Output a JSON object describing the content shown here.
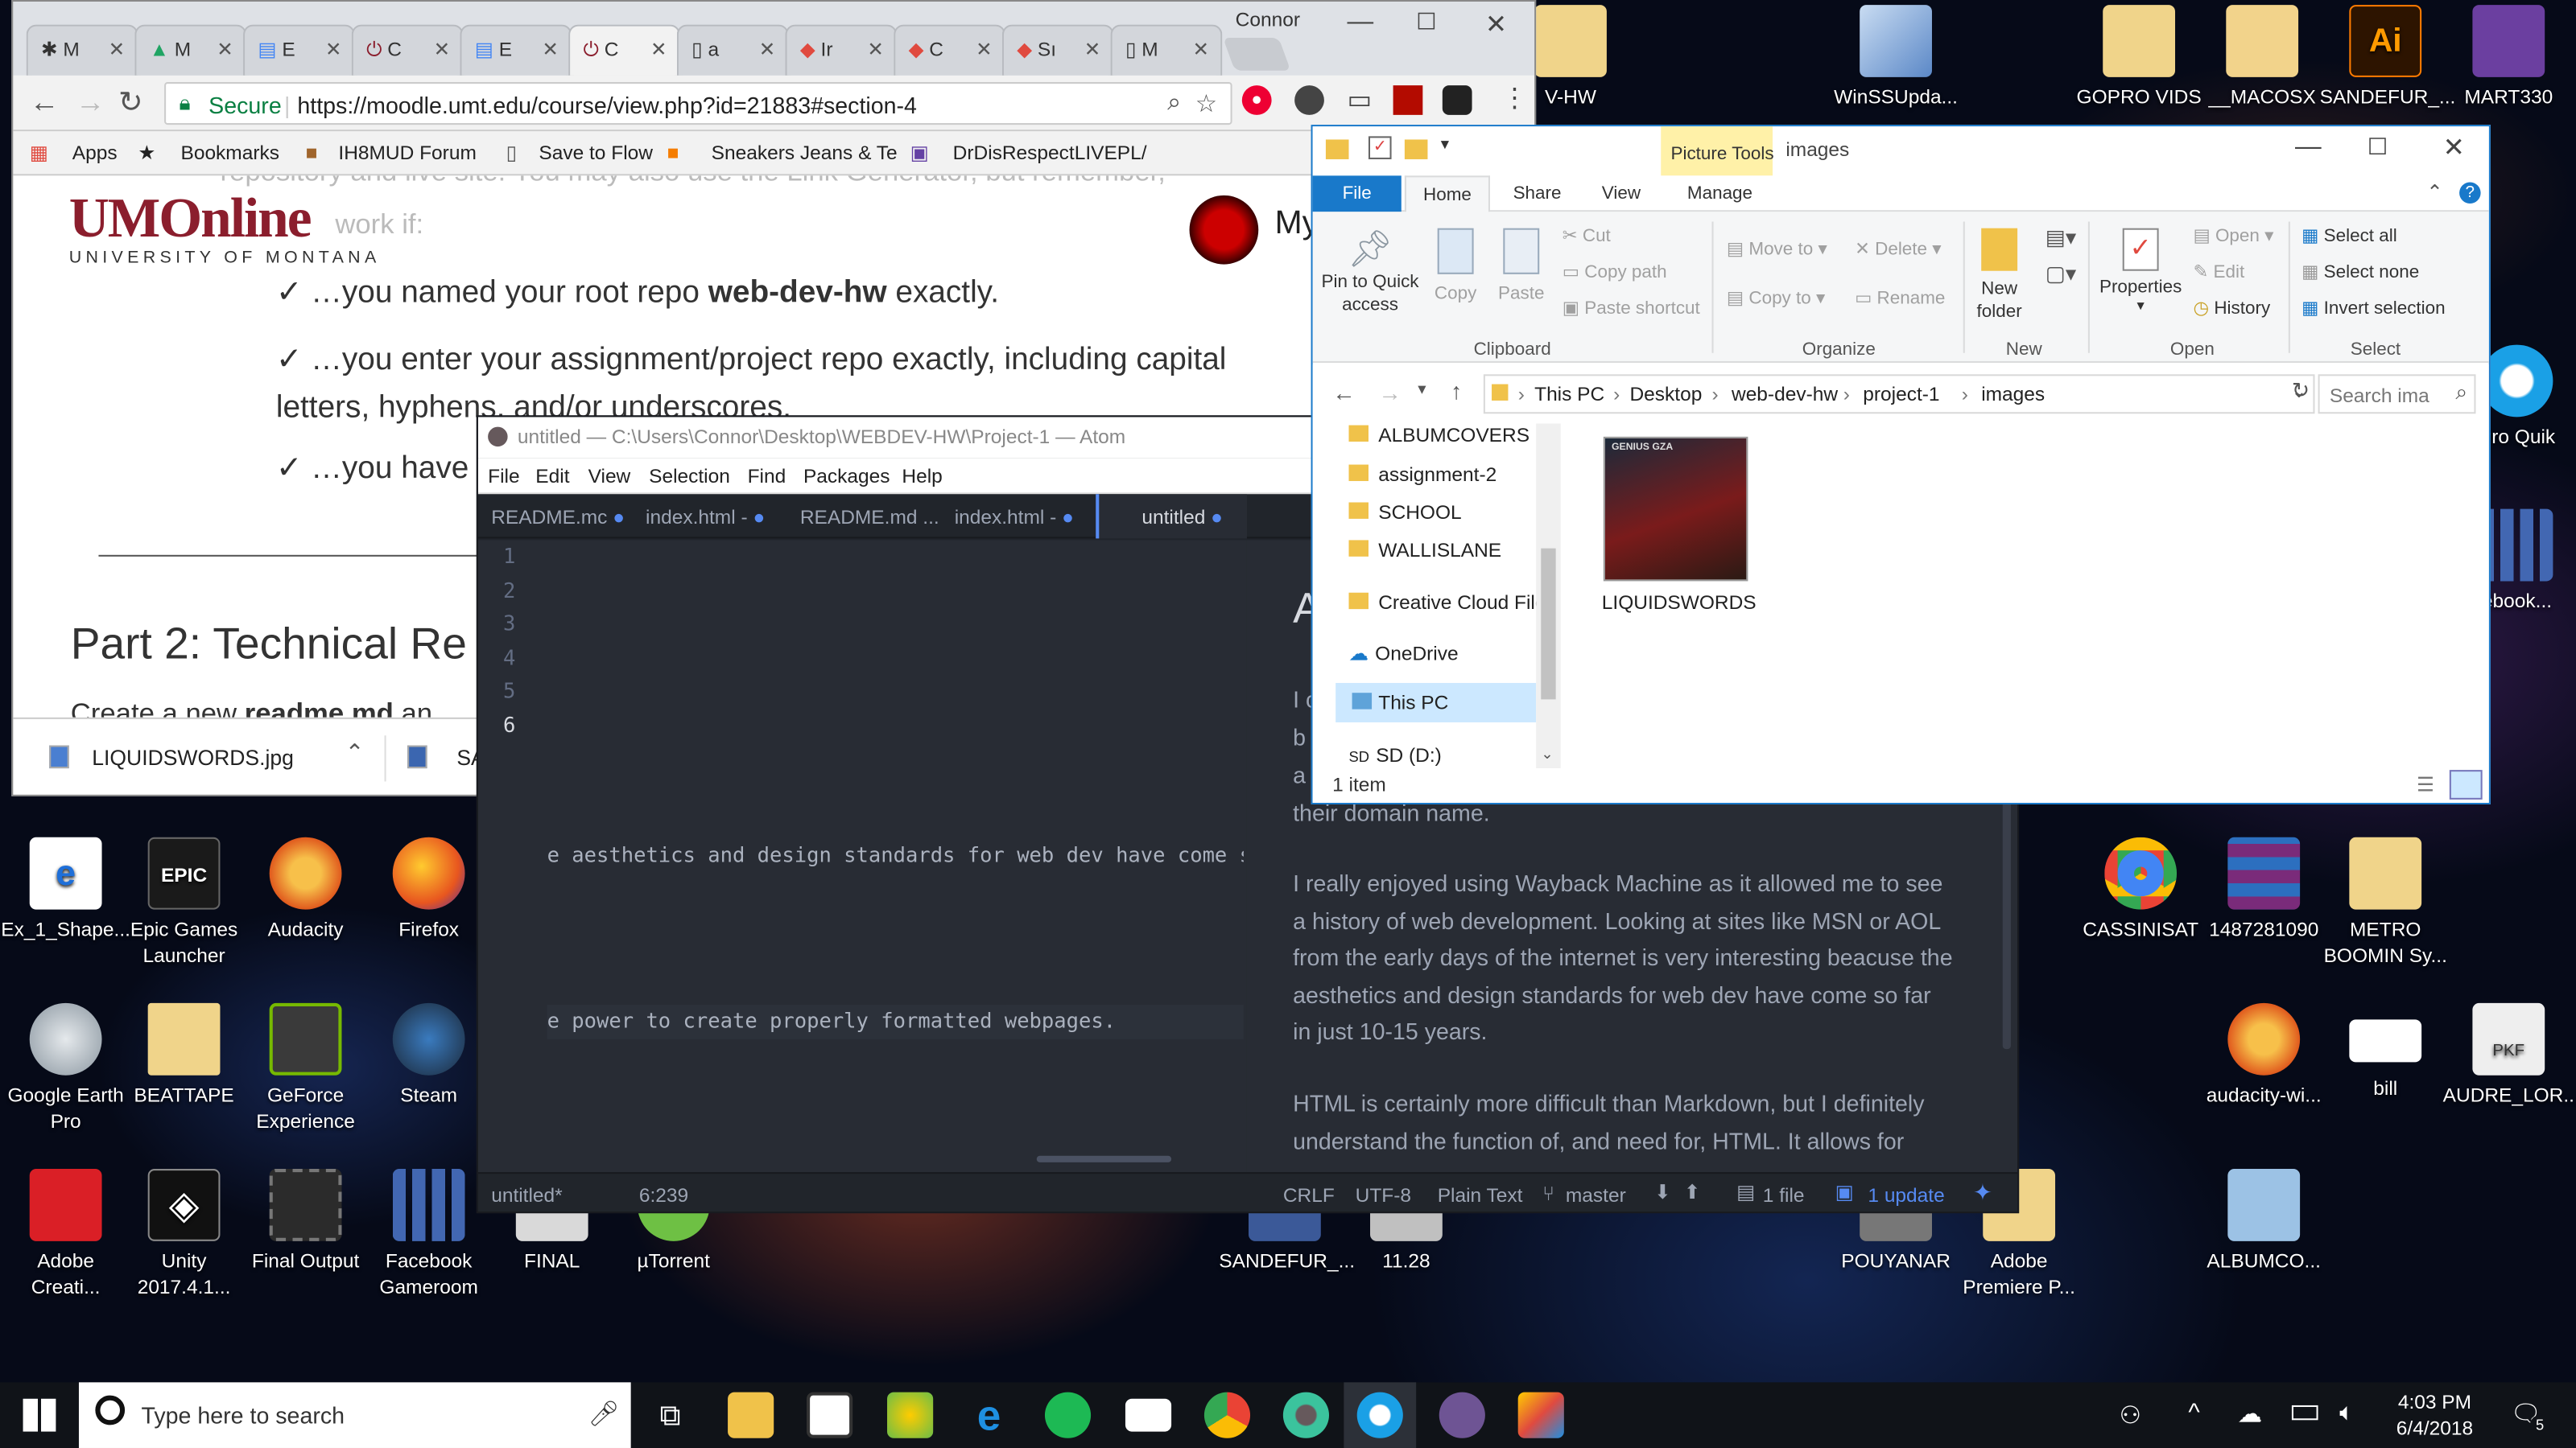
{
  "desktop": {
    "left_icons": [
      {
        "label": "Ex_1_Shape...",
        "icon": "pdf-icon",
        "color": "#1e6fd9"
      },
      {
        "label": "Epic Games Launcher",
        "icon": "epic-games-icon",
        "color": "#222222"
      },
      {
        "label": "Audacity",
        "icon": "audacity-icon",
        "color": "#f29a1c"
      },
      {
        "label": "Firefox",
        "icon": "firefox-icon",
        "color": "#e8561f"
      },
      {
        "label": "Google Earth Pro",
        "icon": "google-earth-icon",
        "color": "#cfd6dc"
      },
      {
        "label": "BEATTAPE",
        "icon": "folder-icon",
        "color": "#e9c46a"
      },
      {
        "label": "GeForce Experience",
        "icon": "geforce-icon",
        "color": "#76b900"
      },
      {
        "label": "Steam",
        "icon": "steam-icon",
        "color": "#1b2838"
      },
      {
        "label": "Adobe Creati...",
        "icon": "adobe-cc-icon",
        "color": "#da1f26"
      },
      {
        "label": "Unity 2017.4.1...",
        "icon": "unity-icon",
        "color": "#222222"
      },
      {
        "label": "Final Output",
        "icon": "video-file-icon",
        "color": "#2a2a2a"
      },
      {
        "label": "Facebook Gameroom",
        "icon": "facebook-gameroom-icon",
        "color": "#2d4b9a"
      },
      {
        "label": "FINAL",
        "icon": "file-icon",
        "color": "#d9d9d9"
      },
      {
        "label": "µTorrent",
        "icon": "utorrent-icon",
        "color": "#6ec044"
      },
      {
        "label": "SANDEFUR_...",
        "icon": "file-icon",
        "color": "#3b5998"
      },
      {
        "label": "11.28",
        "icon": "file-icon",
        "color": "#c0c0c0"
      }
    ],
    "right_icons": [
      {
        "label": "V-HW",
        "icon": "folder-icon",
        "color": "#e9c46a"
      },
      {
        "label": "WinSSUpda...",
        "icon": "winssupdate-icon",
        "color": "#5b88c7"
      },
      {
        "label": "GOPRO VIDS",
        "icon": "folder-icon",
        "color": "#e9c46a"
      },
      {
        "label": "__MACOSX",
        "icon": "folder-icon",
        "color": "#f2d38b"
      },
      {
        "label": "SANDEFUR_...",
        "icon": "illustrator-icon",
        "color": "#ff7c00"
      },
      {
        "label": "MART330",
        "icon": "folder-icon",
        "color": "#6b3fa0"
      },
      {
        "label": "Pro Quik",
        "icon": "quik-icon",
        "color": "#1aa0e6"
      },
      {
        "label": "ebook...",
        "icon": "facebook-gameroom-icon",
        "color": "#2d4b9a"
      },
      {
        "label": "CASSINISAT",
        "icon": "chrome-icon",
        "color": "#4285f4"
      },
      {
        "label": "1487281090",
        "icon": "winrar-icon",
        "color": "#7a2b7a"
      },
      {
        "label": "METRO BOOMIN Sy...",
        "icon": "folder-icon",
        "color": "#e9c46a"
      },
      {
        "label": "audacity-wi...",
        "icon": "audacity-icon",
        "color": "#f29a1c"
      },
      {
        "label": "bill",
        "icon": "file-icon",
        "color": "#ffffff"
      },
      {
        "label": "AUDRE_LOR...",
        "icon": "pkf-icon",
        "color": "#eeeeee"
      },
      {
        "label": "POUYANAR",
        "icon": "file-icon",
        "color": "#888888"
      },
      {
        "label": "Adobe Premiere P...",
        "icon": "folder-icon",
        "color": "#e9c46a"
      },
      {
        "label": "ALBUMCO...",
        "icon": "folder-icon",
        "color": "#9cc2e5"
      }
    ]
  },
  "chrome": {
    "profile_name": "Connor",
    "tabs": [
      {
        "label": "M",
        "icon": "moodle-icon"
      },
      {
        "label": "M",
        "icon": "drive-icon"
      },
      {
        "label": "E",
        "icon": "docs-icon"
      },
      {
        "label": "C",
        "icon": "umonline-icon"
      },
      {
        "label": "E",
        "icon": "docs-icon"
      },
      {
        "label": "C",
        "icon": "umonline-icon"
      },
      {
        "label": "a",
        "icon": "page-icon"
      },
      {
        "label": "Ir",
        "icon": "gem-icon"
      },
      {
        "label": "C",
        "icon": "gem-icon"
      },
      {
        "label": "Sı",
        "icon": "gem-icon"
      },
      {
        "label": "M",
        "icon": "page-icon"
      }
    ],
    "secure_label": "Secure",
    "url": "https://moodle.umt.edu/course/view.php?id=21883#section-4",
    "bookmarks": [
      "Apps",
      "Bookmarks",
      "IH8MUD Forum",
      "Save to Flow",
      "Sneakers Jeans & Te",
      "DrDisRespectLIVEPL/"
    ],
    "logo_text": "UMOnline",
    "logo_sub": "UNIVERSITY OF MONTANA",
    "user_short": "My",
    "content": {
      "line_top": "repository and live site. You may also use the Link Generator, but remember,",
      "line_top2": "work if:",
      "check1_pre": "…you named your root repo ",
      "check1_bold": "web-dev-hw",
      "check1_post": " exactly.",
      "check2": "…you enter your assignment/project repo exactly, including capital letters, hyphens, and/or underscores.",
      "check3": "…you have r",
      "check_mark": "✓",
      "part2": "Part 2: Technical Re",
      "create_pre": "Create a new ",
      "create_bold": "readme.md",
      "create_post": " an"
    },
    "download_file": "LIQUIDSWORDS.jpg",
    "download_file2": "SA"
  },
  "atom": {
    "title": "untitled — C:\\Users\\Connor\\Desktop\\WEBDEV-HW\\Project-1 — Atom",
    "menu": [
      "File",
      "Edit",
      "View",
      "Selection",
      "Find",
      "Packages",
      "Help"
    ],
    "tabs": [
      "README.mc",
      "index.html -",
      "README.md ...",
      "index.html -",
      "untitled"
    ],
    "lines": [
      "",
      "",
      "",
      "e aesthetics and design standards for web dev have come s",
      "",
      "e power to create properly formatted webpages."
    ],
    "line_numbers": [
      "1",
      "2",
      "3",
      "4",
      "5",
      "6"
    ],
    "preview_head": "A",
    "preview_frag": [
      "I c",
      "b",
      "a",
      "their domain name."
    ],
    "preview_p1": "I really enjoyed using Wayback Machine as it allowed me to see a history of web development. Looking at sites like MSN or AOL from the early days of the internet is very interesting beacuse the aesthetics and design standards for web dev have come so far in just 10-15 years.",
    "preview_p2": "HTML is certainly more difficult than Markdown, but I definitely understand the function of, and need for, HTML. It allows for",
    "status": {
      "file": "untitled*",
      "cursor": "6:239",
      "eol": "CRLF",
      "encoding": "UTF-8",
      "grammar": "Plain Text",
      "branch": "master",
      "files": "1 file",
      "update": "1 update"
    }
  },
  "explorer": {
    "context_tab": "Picture Tools",
    "title": "images",
    "ribbon_tabs": [
      "File",
      "Home",
      "Share",
      "View",
      "Manage"
    ],
    "clipboard": {
      "pin": "Pin to Quick access",
      "copy": "Copy",
      "paste": "Paste",
      "cut": "Cut",
      "copy_path": "Copy path",
      "paste_shortcut": "Paste shortcut",
      "group": "Clipboard"
    },
    "organize": {
      "move_to": "Move to",
      "copy_to": "Copy to",
      "delete": "Delete",
      "rename": "Rename",
      "group": "Organize"
    },
    "new": {
      "new_folder": "New folder",
      "group": "New"
    },
    "open": {
      "properties": "Properties",
      "open": "Open",
      "edit": "Edit",
      "history": "History",
      "group": "Open"
    },
    "select": {
      "select_all": "Select all",
      "select_none": "Select none",
      "invert": "Invert selection",
      "group": "Select"
    },
    "breadcrumb": [
      "This PC",
      "Desktop",
      "web-dev-hw",
      "project-1",
      "images"
    ],
    "search_placeholder": "Search ima",
    "nav_items": [
      "ALBUMCOVERS",
      "assignment-2",
      "SCHOOL",
      "WALLISLANE",
      "Creative Cloud File",
      "OneDrive",
      "This PC",
      "SD (D:)"
    ],
    "file": {
      "name": "LIQUIDSWORDS",
      "cover_text": "GENIUS GZA"
    },
    "status": "1 item"
  },
  "taskbar": {
    "search_placeholder": "Type here to search",
    "time": "4:03 PM",
    "date": "6/4/2018",
    "notif_count": "5",
    "apps": [
      "task-view-icon",
      "file-explorer-icon",
      "store-icon",
      "paint-icon",
      "edge-icon",
      "spotify-icon",
      "mail-icon",
      "chrome-icon",
      "atom-icon",
      "quik-icon",
      "github-icon",
      "paint-3d-icon"
    ]
  }
}
